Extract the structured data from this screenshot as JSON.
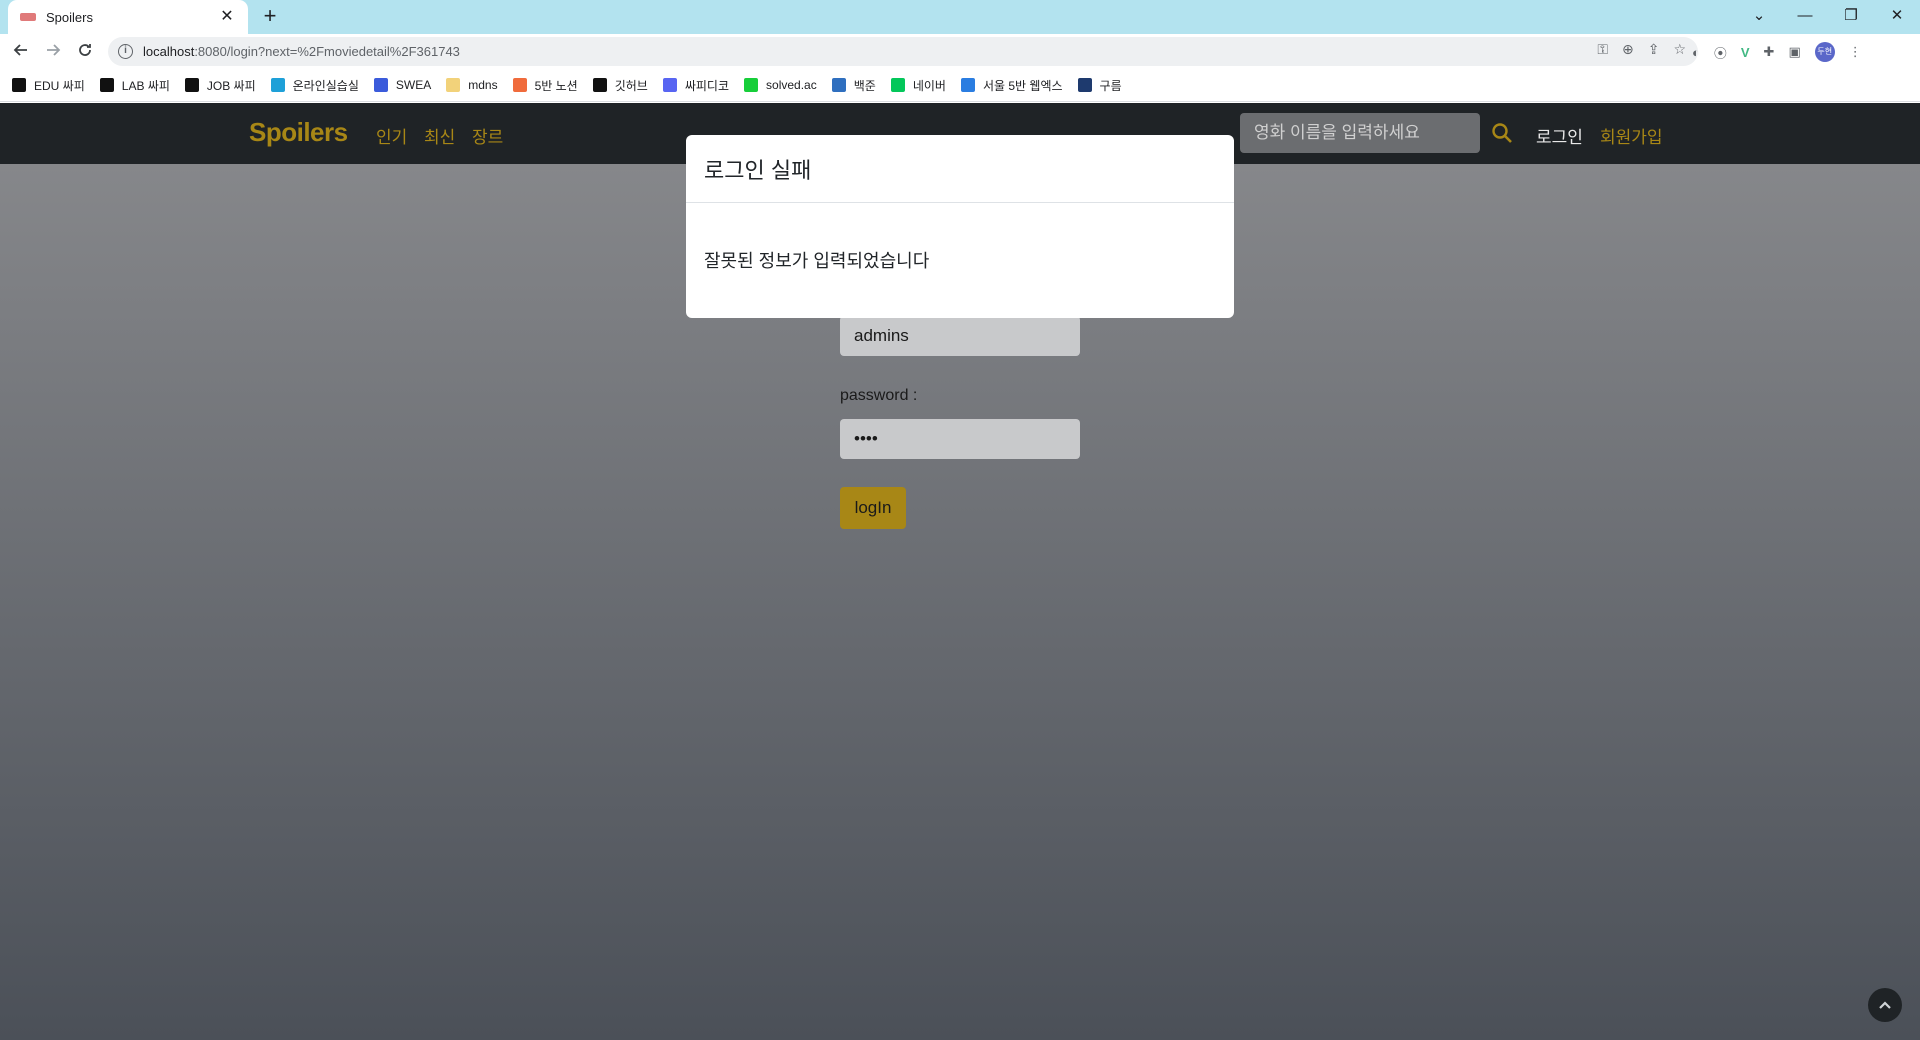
{
  "browser": {
    "tab_title": "Spoilers",
    "tab_close": "✕",
    "new_tab": "+",
    "url_host": "localhost",
    "url_rest": ":8080/login?next=%2Fmoviedetail%2F361743",
    "window_controls": {
      "minimize": "—",
      "restore": "❐",
      "close": "✕",
      "tabs_menu": "⌄"
    },
    "avatar_text": "두현"
  },
  "bookmarks": [
    {
      "label": "EDU 싸피",
      "color": "#111111"
    },
    {
      "label": "LAB 싸피",
      "color": "#111111"
    },
    {
      "label": "JOB 싸피",
      "color": "#111111"
    },
    {
      "label": "온라인실습실",
      "color": "#1ea0d8"
    },
    {
      "label": "SWEA",
      "color": "#3b5bdb"
    },
    {
      "label": "mdns",
      "color": "#f2d27a"
    },
    {
      "label": "5반 노션",
      "color": "#f06b3c"
    },
    {
      "label": "깃허브",
      "color": "#111111"
    },
    {
      "label": "싸피디코",
      "color": "#5865f2"
    },
    {
      "label": "solved.ac",
      "color": "#17ce3a"
    },
    {
      "label": "백준",
      "color": "#2f6fbf"
    },
    {
      "label": "네이버",
      "color": "#03c75a"
    },
    {
      "label": "서울 5반 웹엑스",
      "color": "#2a7de1"
    },
    {
      "label": "구름",
      "color": "#1e3a6e"
    }
  ],
  "site": {
    "brand": "Spoilers",
    "nav": {
      "popular": "인기",
      "latest": "최신",
      "genre": "장르"
    },
    "search_placeholder": "영화 이름을 입력하세요",
    "login_link": "로그인",
    "signup_link": "회원가입"
  },
  "login_form": {
    "username_value": "admins",
    "password_label": "password :",
    "password_value": "••••",
    "submit_label": "logIn"
  },
  "modal": {
    "title": "로그인 실패",
    "message": "잘못된 정보가 입력되었습니다"
  },
  "colors": {
    "accent": "#a88716",
    "navbar": "#1f2326",
    "tabbar": "#b3e3ef"
  }
}
